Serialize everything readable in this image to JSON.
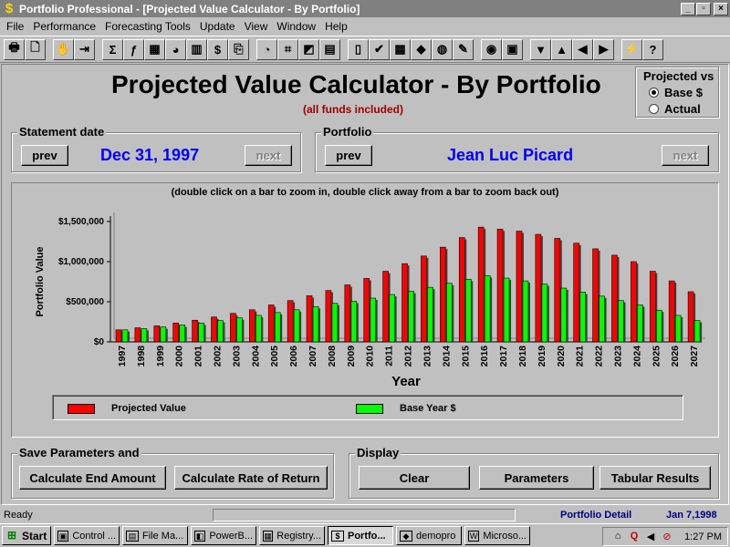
{
  "window": {
    "title": "Portfolio Professional - [Projected Value Calculator - By Portfolio]",
    "controls": [
      "_",
      "▫",
      "×"
    ]
  },
  "menu": [
    "File",
    "Performance",
    "Forecasting Tools",
    "Update",
    "View",
    "Window",
    "Help"
  ],
  "toolbar": {
    "buttons": [
      "printer-icon",
      "preview-icon",
      "stop-icon",
      "exit-icon",
      "sigma-icon",
      "function-icon",
      "table-icon",
      "chart-pie-icon",
      "bar-chart-icon",
      "money-bag-icon",
      "copy-icon",
      "pie-icon",
      "network-icon",
      "chart-line-icon",
      "calendar-icon",
      "book-icon",
      "check-icon",
      "grid-icon",
      "shapes-icon",
      "coin-icon",
      "hand-icon",
      "globe-icon",
      "map-icon",
      "down-arrow-icon",
      "up-arrow-icon",
      "left-arrow-icon",
      "right-arrow-icon",
      "lightning-icon",
      "question-icon"
    ],
    "glyphs": [
      "🖶",
      "🗋",
      "✋",
      "⇥",
      "Σ",
      "ƒ",
      "▦",
      "◕",
      "▥",
      "$",
      "⎘",
      "◔",
      "⌗",
      "◩",
      "▤",
      "▯",
      "✔",
      "▩",
      "◆",
      "◍",
      "✎",
      "◉",
      "▣",
      "▼",
      "▲",
      "◀",
      "▶",
      "⚡",
      "?"
    ]
  },
  "header": {
    "title": "Projected Value Calculator - By Portfolio",
    "subtitle": "(all funds included)"
  },
  "projected_vs": {
    "title": "Projected vs",
    "options": [
      "Base $",
      "Actual"
    ],
    "selected": "Base $"
  },
  "statement": {
    "legend": "Statement date",
    "prev": "prev",
    "next": "next",
    "date": "Dec 31, 1997"
  },
  "portfolio": {
    "legend": "Portfolio",
    "prev": "prev",
    "next": "next",
    "name": "Jean Luc Picard"
  },
  "chart_note": "(double click on a bar to zoom in, double click away from a bar to zoom back out)",
  "chart_data": {
    "type": "bar",
    "xlabel": "Year",
    "ylabel": "Portfolio Value",
    "ylim": [
      0,
      1500000
    ],
    "yticks": [
      0,
      500000,
      1000000,
      1500000
    ],
    "ytick_labels": [
      "$0",
      "$500,000",
      "$1,000,000",
      "$1,500,000"
    ],
    "categories": [
      "1997",
      "1998",
      "1999",
      "2000",
      "2001",
      "2002",
      "2003",
      "2004",
      "2005",
      "2006",
      "2007",
      "2008",
      "2009",
      "2010",
      "2011",
      "2012",
      "2013",
      "2014",
      "2015",
      "2016",
      "2017",
      "2018",
      "2019",
      "2020",
      "2021",
      "2022",
      "2023",
      "2024",
      "2025",
      "2026",
      "2027"
    ],
    "series": [
      {
        "name": "Projected Value",
        "color": "#ff0000",
        "values": [
          150000,
          175000,
          200000,
          235000,
          270000,
          310000,
          355000,
          400000,
          460000,
          515000,
          575000,
          640000,
          710000,
          790000,
          880000,
          975000,
          1070000,
          1180000,
          1300000,
          1430000,
          1405000,
          1380000,
          1340000,
          1290000,
          1230000,
          1160000,
          1080000,
          1000000,
          880000,
          760000,
          625000
        ]
      },
      {
        "name": "Base Year $",
        "color": "#00ff00",
        "values": [
          150000,
          165000,
          185000,
          210000,
          235000,
          265000,
          300000,
          330000,
          365000,
          400000,
          440000,
          480000,
          505000,
          545000,
          590000,
          630000,
          680000,
          730000,
          780000,
          825000,
          795000,
          760000,
          720000,
          670000,
          620000,
          570000,
          515000,
          460000,
          395000,
          330000,
          265000
        ]
      }
    ],
    "legend": [
      "Projected Value",
      "Base Year $"
    ]
  },
  "params_group": {
    "legend": "Save Parameters and",
    "buttons": [
      "Calculate End Amount",
      "Calculate Rate of Return"
    ]
  },
  "display_group": {
    "legend": "Display",
    "buttons": [
      "Clear",
      "Parameters",
      "Tabular Results"
    ]
  },
  "status": {
    "ready": "Ready",
    "view": "Portfolio Detail",
    "date": "Jan 7,1998"
  },
  "taskbar": {
    "start": "Start",
    "tasks": [
      "Control ...",
      "File Ma...",
      "PowerB...",
      "Registry...",
      "Portfo...",
      "demopro",
      "Microso..."
    ],
    "active": "Portfo...",
    "time": "1:27 PM"
  }
}
